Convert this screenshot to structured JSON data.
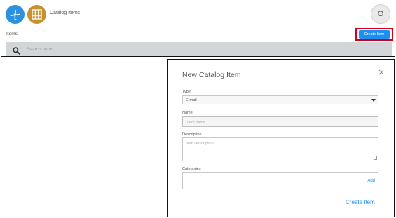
{
  "header": {
    "title": "Catalog Items",
    "avatar_initial": "O"
  },
  "subbar": {
    "label": "Items",
    "create_button": "Create Item"
  },
  "search": {
    "placeholder": "Search Items"
  },
  "modal": {
    "title": "New Catalog Item",
    "type_label": "Type",
    "type_value": "E-mail",
    "name_label": "Name",
    "name_placeholder": "Item name",
    "description_label": "Description",
    "description_placeholder": "Item Description",
    "categories_label": "Categories",
    "add_label": "Add",
    "create_label": "Create Item"
  },
  "colors": {
    "accent": "#1e8ff0",
    "highlight": "#d0021b",
    "plane_icon_bg": "#2b92e0",
    "grid_icon_bg": "#c7922d",
    "search_bar_bg": "#d3d6d9"
  },
  "icons": {
    "app_primary": "airplane-icon",
    "app_secondary": "grid-icon",
    "search": "search-icon",
    "close": "close-icon",
    "dropdown": "caret-down-icon"
  }
}
